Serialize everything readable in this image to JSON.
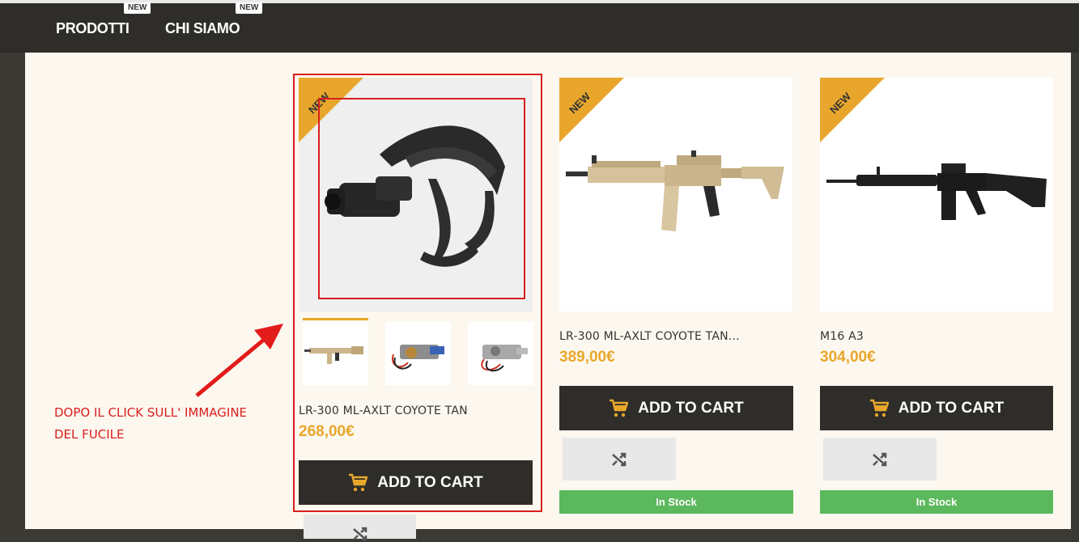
{
  "nav": {
    "items": [
      {
        "label": "PRODOTTI",
        "badge": "NEW"
      },
      {
        "label": "CHI SIAMO",
        "badge": "NEW"
      }
    ]
  },
  "ribbon_label": "NEW",
  "products": [
    {
      "title": "LR-300 ML-AXLT COYOTE TAN",
      "price": "268,00€",
      "cart_label": "ADD TO CART",
      "image": "night-vision-goggle",
      "thumbnails": [
        "rifle-thumb",
        "gearbox-wired-thumb",
        "gearbox-thumb"
      ]
    },
    {
      "title": "LR-300 ML-AXLT COYOTE TAN...",
      "price": "389,00€",
      "cart_label": "ADD TO CART",
      "stock": "In Stock",
      "image": "tan-rifle"
    },
    {
      "title": "M16 A3",
      "price": "304,00€",
      "cart_label": "ADD TO CART",
      "stock": "In Stock",
      "image": "black-rifle"
    }
  ],
  "annotation": {
    "line1": "DOPO IL CLICK SULL' IMMAGINE",
    "line2": "DEL FUCILE"
  },
  "colors": {
    "accent": "#e8a72c",
    "dark": "#2f2d29",
    "stock_green": "#5cb85c",
    "annotation_red": "#d91e1e"
  }
}
